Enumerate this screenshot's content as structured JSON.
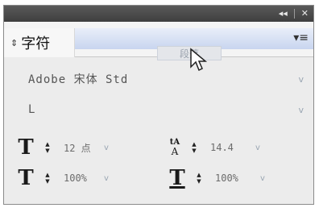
{
  "window": {
    "collapse_glyph": "◂◂",
    "close_glyph": "✕"
  },
  "tabs": {
    "active_label": "字符",
    "active_toggle_glyph": "⇕",
    "inactive_label": "段落",
    "menu_glyph": "▾≡"
  },
  "font": {
    "family": "Adobe 宋体 Std",
    "style": "L",
    "dropdown_glyph": "v"
  },
  "metrics": {
    "font_size": {
      "value": "12 点",
      "icon": "T"
    },
    "leading": {
      "value": "14.4",
      "icon": "A"
    },
    "vertical_scale": {
      "value": "100%",
      "icon": "T"
    },
    "horizontal_scale": {
      "value": "100%",
      "icon": "T"
    },
    "stepper_up": "▲",
    "stepper_down": "▼",
    "dropdown_glyph": "v"
  },
  "colors": {
    "titlebar": "#4a4a4a",
    "panel_bg": "#ececec",
    "tab_highlight": "#c8d5ef"
  }
}
